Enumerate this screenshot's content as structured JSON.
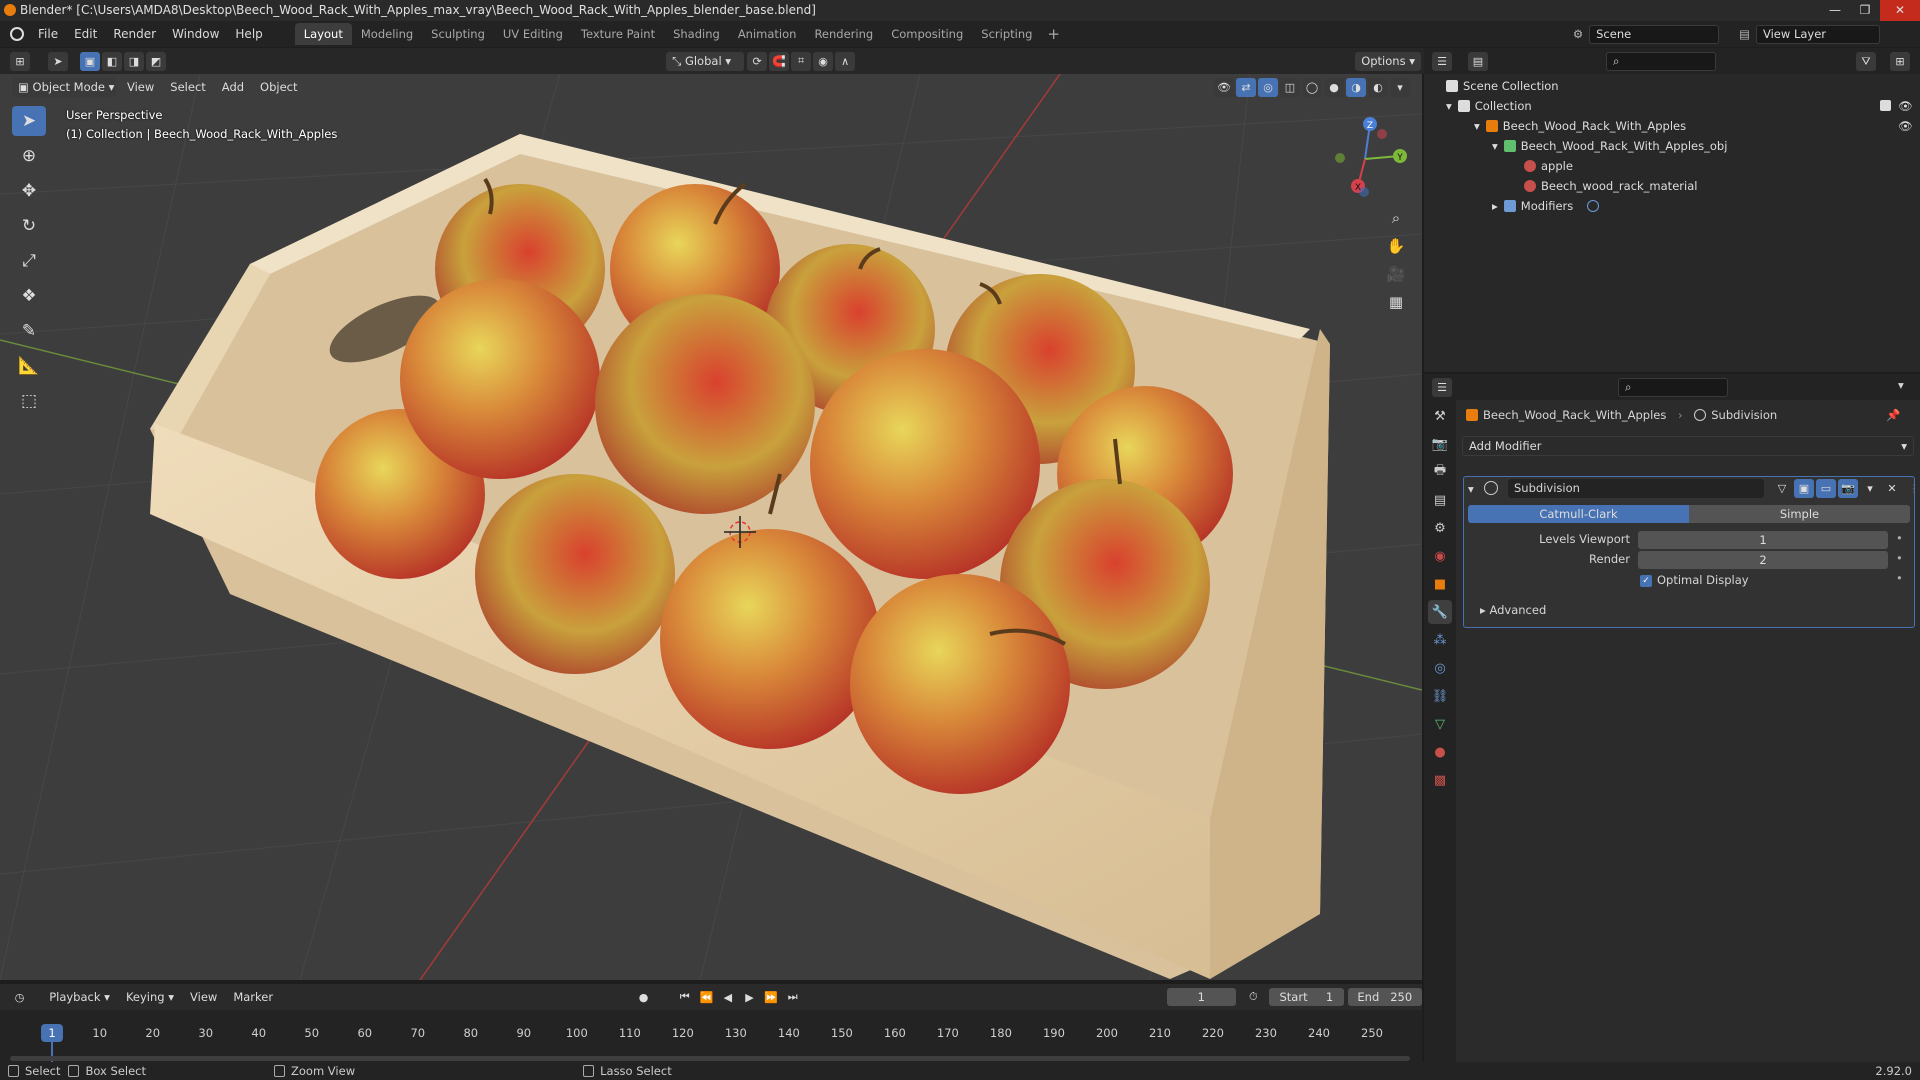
{
  "window": {
    "title": "Blender* [C:\\Users\\AMDA8\\Desktop\\Beech_Wood_Rack_With_Apples_max_vray\\Beech_Wood_Rack_With_Apples_blender_base.blend]",
    "min": "—",
    "max": "❐",
    "close": "✕"
  },
  "menu": {
    "items": [
      "File",
      "Edit",
      "Render",
      "Window",
      "Help"
    ],
    "workspaces": [
      "Layout",
      "Modeling",
      "Sculpting",
      "UV Editing",
      "Texture Paint",
      "Shading",
      "Animation",
      "Rendering",
      "Compositing",
      "Scripting"
    ],
    "add_workspace": "+",
    "scene": "Scene",
    "view_layer": "View Layer"
  },
  "toolbar": {
    "transform_orientation": "Global",
    "options": "Options"
  },
  "viewport_header": {
    "mode": "Object Mode",
    "menus": [
      "View",
      "Select",
      "Add",
      "Object"
    ]
  },
  "viewport": {
    "perspective": "User Perspective",
    "collection_info": "(1) Collection | Beech_Wood_Rack_With_Apples",
    "gizmo": {
      "x": "X",
      "y": "Y",
      "z": "Z"
    }
  },
  "outliner": {
    "scene_collection": "Scene Collection",
    "collection": "Collection",
    "object": "Beech_Wood_Rack_With_Apples",
    "mesh": "Beech_Wood_Rack_With_Apples_obj",
    "material1": "apple",
    "material2": "Beech_wood_rack_material",
    "modifiers": "Modifiers"
  },
  "properties": {
    "object_name": "Beech_Wood_Rack_With_Apples",
    "modifier_name": "Subdivision",
    "add_modifier": "Add Modifier",
    "modifier": {
      "name": "Subdivision",
      "type_a": "Catmull-Clark",
      "type_b": "Simple",
      "selected_type": "Catmull-Clark",
      "levels_viewport_label": "Levels Viewport",
      "levels_viewport": "1",
      "render_label": "Render",
      "render": "2",
      "optimal_display_label": "Optimal Display",
      "optimal_display": true,
      "advanced": "Advanced"
    }
  },
  "timeline": {
    "menus": [
      "Playback",
      "Keying",
      "View",
      "Marker"
    ],
    "current_frame": "1",
    "start_label": "Start",
    "start": "1",
    "end_label": "End",
    "end": "250",
    "ticks": [
      "10",
      "20",
      "30",
      "40",
      "50",
      "60",
      "70",
      "80",
      "90",
      "100",
      "110",
      "120",
      "130",
      "140",
      "150",
      "160",
      "170",
      "180",
      "190",
      "200",
      "210",
      "220",
      "230",
      "240",
      "250"
    ]
  },
  "statusbar": {
    "select": "Select",
    "box_select": "Box Select",
    "zoom_view": "Zoom View",
    "lasso_select": "Lasso Select",
    "version": "2.92.0"
  },
  "colors": {
    "accent": "#4772b3",
    "object_orange": "#e87d0d",
    "apple_red": "#c83a2a",
    "apple_yellow": "#c9b83c",
    "wood": "#e6cfa8"
  }
}
